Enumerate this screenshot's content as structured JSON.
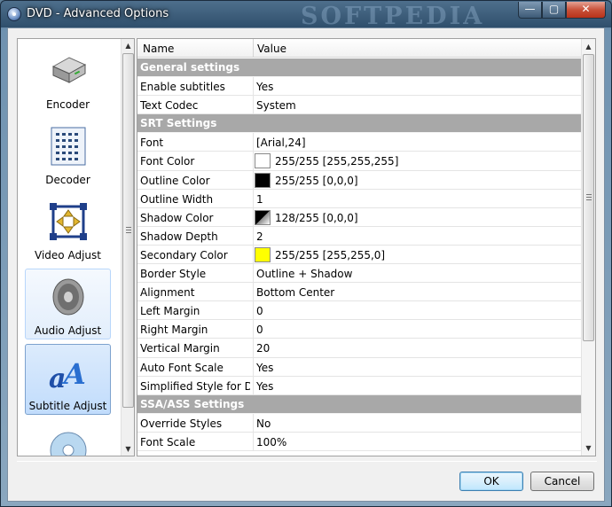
{
  "window": {
    "title": "DVD - Advanced Options",
    "watermark": "SOFTPEDIA",
    "minimize_glyph": "—",
    "maximize_glyph": "▢",
    "close_glyph": "✕"
  },
  "nav": {
    "items": [
      {
        "label": "Encoder",
        "icon": "drive-icon",
        "state": "normal"
      },
      {
        "label": "Decoder",
        "icon": "chip-icon",
        "state": "normal"
      },
      {
        "label": "Video Adjust",
        "icon": "crop-arrows-icon",
        "state": "normal"
      },
      {
        "label": "Audio Adjust",
        "icon": "speaker-icon",
        "state": "hover"
      },
      {
        "label": "Subtitle Adjust",
        "icon": "subtitle-aa-icon",
        "state": "selected"
      },
      {
        "label": "",
        "icon": "disc-icon",
        "state": "normal"
      }
    ]
  },
  "grid": {
    "header": {
      "name": "Name",
      "value": "Value"
    },
    "rows": [
      {
        "type": "section",
        "name": "General settings"
      },
      {
        "type": "prop",
        "name": "Enable subtitles",
        "value": "Yes"
      },
      {
        "type": "prop",
        "name": "Text Codec",
        "value": "System"
      },
      {
        "type": "section",
        "name": "SRT Settings"
      },
      {
        "type": "prop",
        "name": "Font",
        "value": "[Arial,24]"
      },
      {
        "type": "prop",
        "name": "Font Color",
        "value": "255/255 [255,255,255]",
        "swatch": "#ffffff"
      },
      {
        "type": "prop",
        "name": "Outline Color",
        "value": "255/255 [0,0,0]",
        "swatch": "#000000"
      },
      {
        "type": "prop",
        "name": "Outline Width",
        "value": "1"
      },
      {
        "type": "prop",
        "name": "Shadow Color",
        "value": "128/255 [0,0,0]",
        "swatch": "half"
      },
      {
        "type": "prop",
        "name": "Shadow Depth",
        "value": "2"
      },
      {
        "type": "prop",
        "name": "Secondary Color",
        "value": "255/255 [255,255,0]",
        "swatch": "#ffff00"
      },
      {
        "type": "prop",
        "name": "Border Style",
        "value": "Outline + Shadow"
      },
      {
        "type": "prop",
        "name": "Alignment",
        "value": "Bottom Center"
      },
      {
        "type": "prop",
        "name": "Left Margin",
        "value": "0"
      },
      {
        "type": "prop",
        "name": "Right Margin",
        "value": "0"
      },
      {
        "type": "prop",
        "name": "Vertical Margin",
        "value": "20"
      },
      {
        "type": "prop",
        "name": "Auto Font Scale",
        "value": "Yes"
      },
      {
        "type": "prop",
        "name": "Simplified Style for D...",
        "value": "Yes"
      },
      {
        "type": "section",
        "name": "SSA/ASS Settings"
      },
      {
        "type": "prop",
        "name": "Override Styles",
        "value": "No"
      },
      {
        "type": "prop",
        "name": "Font Scale",
        "value": "100%"
      }
    ]
  },
  "buttons": {
    "ok": "OK",
    "cancel": "Cancel"
  },
  "scroll_glyphs": {
    "up": "▲",
    "down": "▼"
  }
}
